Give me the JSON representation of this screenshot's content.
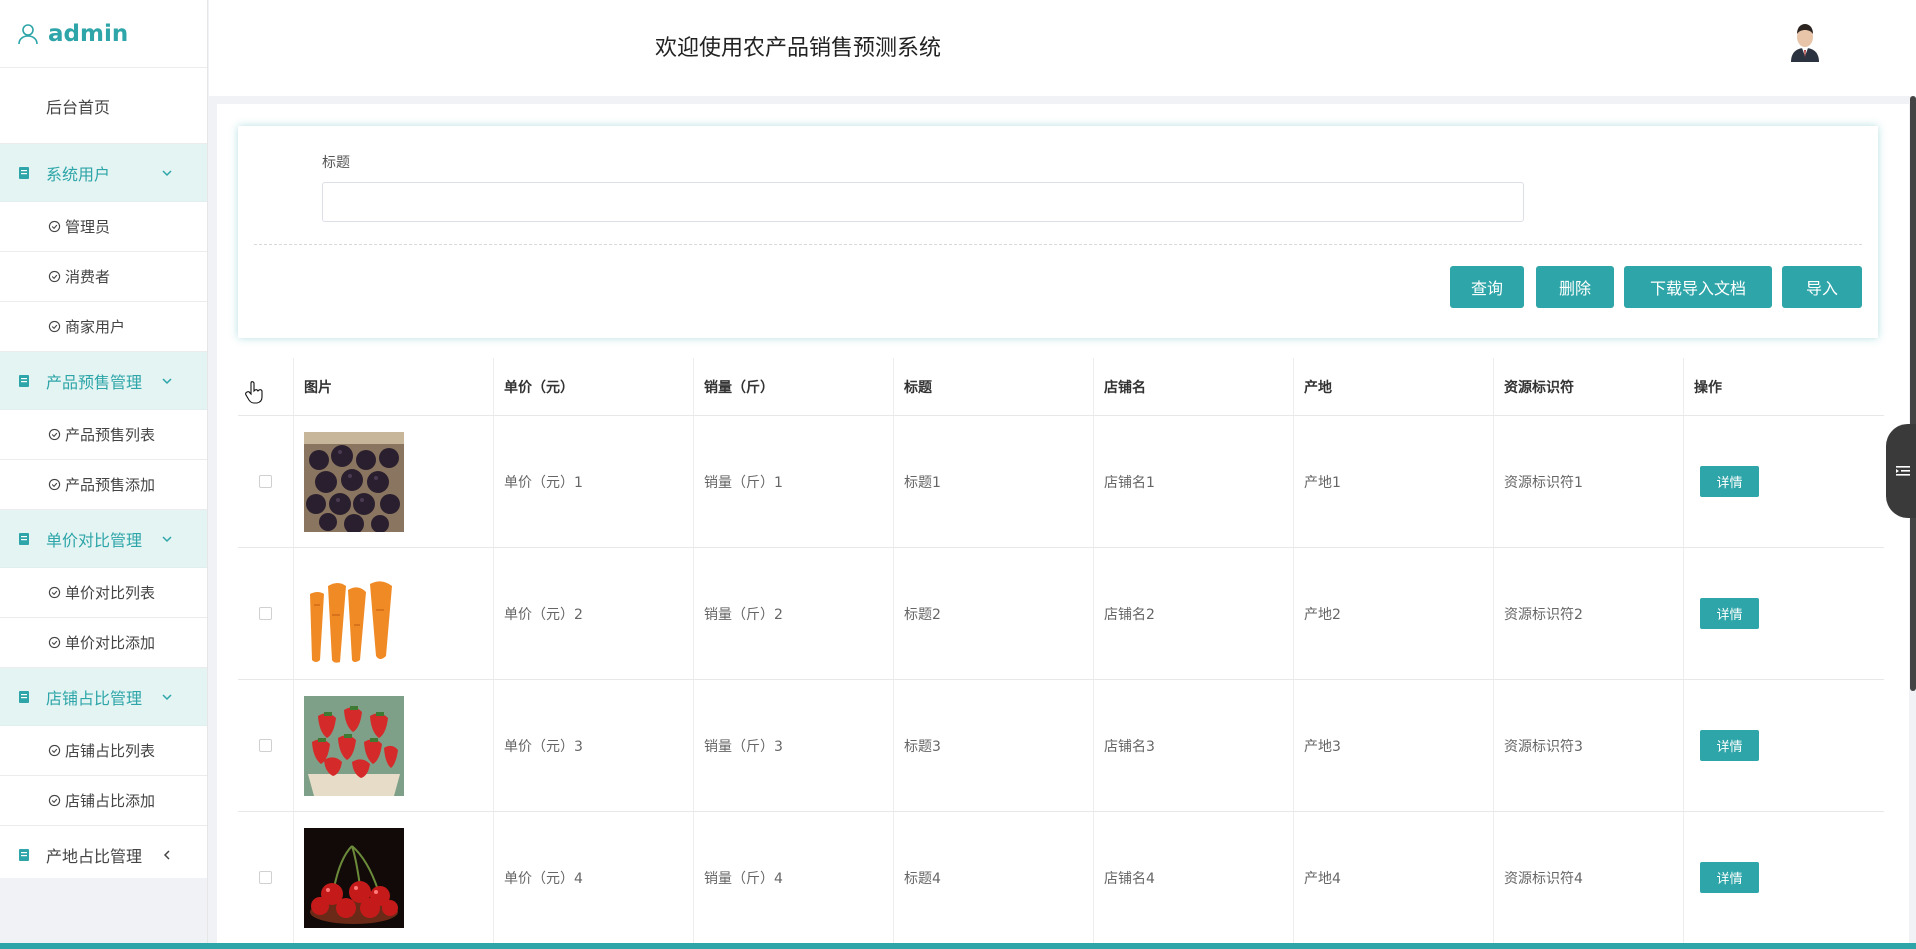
{
  "brand": {
    "name": "admin"
  },
  "header": {
    "title": "欢迎使用农产品销售预测系统"
  },
  "sidebar": {
    "home": "后台首页",
    "groups": [
      {
        "label": "系统用户",
        "expanded": true,
        "items": [
          "管理员",
          "消费者",
          "商家用户"
        ]
      },
      {
        "label": "产品预售管理",
        "expanded": true,
        "items": [
          "产品预售列表",
          "产品预售添加"
        ]
      },
      {
        "label": "单价对比管理",
        "expanded": true,
        "items": [
          "单价对比列表",
          "单价对比添加"
        ]
      },
      {
        "label": "店铺占比管理",
        "expanded": true,
        "items": [
          "店铺占比列表",
          "店铺占比添加"
        ]
      },
      {
        "label": "产地占比管理",
        "expanded": false,
        "items": []
      }
    ]
  },
  "search": {
    "label": "标题",
    "value": "",
    "placeholder": ""
  },
  "buttons": {
    "query": "查询",
    "delete": "删除",
    "download": "下载导入文档",
    "import": "导入"
  },
  "table": {
    "headers": [
      "图片",
      "单价（元）",
      "销量（斤）",
      "标题",
      "店铺名",
      "产地",
      "资源标识符",
      "操作"
    ],
    "rows": [
      {
        "image": "blackberry",
        "price": "单价（元）1",
        "sales": "销量（斤）1",
        "title": "标题1",
        "shop": "店铺名1",
        "origin": "产地1",
        "uri": "资源标识符1",
        "action": "详情"
      },
      {
        "image": "carrot",
        "price": "单价（元）2",
        "sales": "销量（斤）2",
        "title": "标题2",
        "shop": "店铺名2",
        "origin": "产地2",
        "uri": "资源标识符2",
        "action": "详情"
      },
      {
        "image": "strawberry",
        "price": "单价（元）3",
        "sales": "销量（斤）3",
        "title": "标题3",
        "shop": "店铺名3",
        "origin": "产地3",
        "uri": "资源标识符3",
        "action": "详情"
      },
      {
        "image": "cherry",
        "price": "单价（元）4",
        "sales": "销量（斤）4",
        "title": "标题4",
        "shop": "店铺名4",
        "origin": "产地4",
        "uri": "资源标识符4",
        "action": "详情"
      }
    ]
  },
  "colors": {
    "accent": "#2ea5a8",
    "accent_light": "#e3f4f3"
  }
}
